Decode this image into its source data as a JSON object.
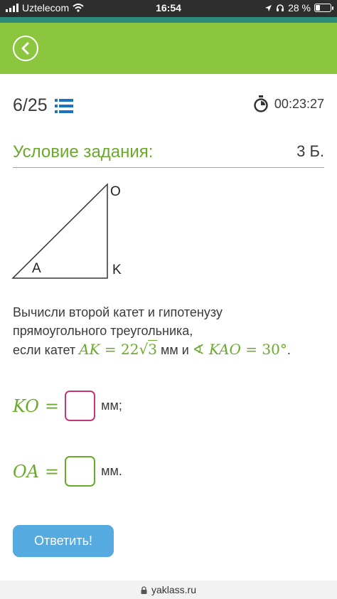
{
  "status_bar": {
    "carrier": "Uztelecom",
    "time": "16:54",
    "battery": "28 %",
    "battery_level": 0.28
  },
  "header": {
    "back_icon": "chevron-left-icon"
  },
  "progress": {
    "text": "6/25",
    "list_icon": "list-icon"
  },
  "timer": {
    "text": "00:23:27",
    "icon": "stopwatch-icon"
  },
  "section": {
    "title": "Условие задания:",
    "points": "3 Б."
  },
  "figure": {
    "vertex_o": "O",
    "vertex_a": "A",
    "vertex_k": "K"
  },
  "task": {
    "line1": "Вычисли второй катет и гипотенузу",
    "line2": "прямоугольного треугольника,",
    "line3_prefix": "если катет ",
    "ak_label": "AK",
    "eq_sign": " = ",
    "ak_coef": "22",
    "sqrt_sign": "√",
    "ak_radicand": "3",
    "mm_and": " мм и ",
    "angle_sign": "∢ ",
    "angle_label": "KAO",
    "angle_value": "30°",
    "period": "."
  },
  "answers": [
    {
      "label": "KO",
      "eq": "=",
      "unit": "мм;",
      "border": "#c0377a"
    },
    {
      "label": "OA",
      "eq": "=",
      "unit": "мм.",
      "border": "#6aaa2a"
    }
  ],
  "submit_label": "Ответить!",
  "bottom": {
    "site": "yaklass.ru",
    "lock_icon": "lock-icon"
  },
  "colors": {
    "brand_green": "#8cc63f",
    "accent_text": "#6aaa2a",
    "teal": "#2e8a7a",
    "button_blue": "#55aadf"
  }
}
